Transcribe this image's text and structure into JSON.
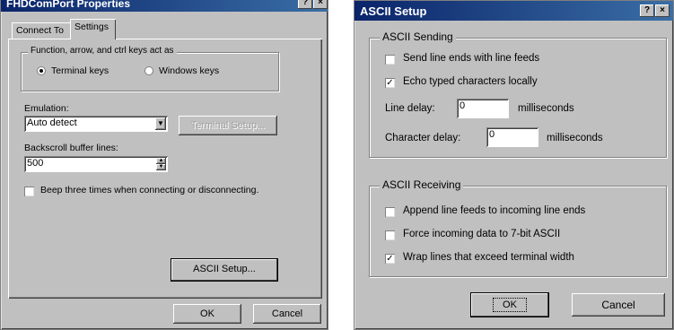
{
  "left_dialog": {
    "title": "FHDComPort Properties",
    "help_btn": "?",
    "close_btn": "×",
    "tabs": [
      {
        "label": "Connect To"
      },
      {
        "label": "Settings"
      }
    ],
    "keys_group": {
      "title": "Function, arrow, and ctrl keys act as",
      "option_terminal": "Terminal keys",
      "option_windows": "Windows keys",
      "selected": "terminal"
    },
    "emulation": {
      "label": "Emulation:",
      "value": "Auto detect",
      "terminal_setup_label": "Terminal Setup..."
    },
    "backscroll": {
      "label": "Backscroll buffer lines:",
      "value": "500"
    },
    "beep_label": "Beep three times when connecting or disconnecting.",
    "ascii_setup_label": "ASCII Setup...",
    "ok_label": "OK",
    "cancel_label": "Cancel"
  },
  "right_dialog": {
    "title": "ASCII Setup",
    "help_btn": "?",
    "close_btn": "×",
    "sending": {
      "title": "ASCII Sending",
      "send_line_ends": {
        "label": "Send line ends with line feeds",
        "checked": false
      },
      "echo_typed": {
        "label": "Echo typed characters locally",
        "checked": true
      },
      "line_delay": {
        "label": "Line delay:",
        "value": "0",
        "unit": "milliseconds"
      },
      "char_delay": {
        "label": "Character delay:",
        "value": "0",
        "unit": "milliseconds"
      }
    },
    "receiving": {
      "title": "ASCII Receiving",
      "append_lf": {
        "label": "Append line feeds to incoming line ends",
        "checked": false
      },
      "force_7bit": {
        "label": "Force incoming data to 7-bit ASCII",
        "checked": false
      },
      "wrap_lines": {
        "label": "Wrap lines that exceed terminal width",
        "checked": true
      }
    },
    "ok_label": "OK",
    "cancel_label": "Cancel"
  }
}
